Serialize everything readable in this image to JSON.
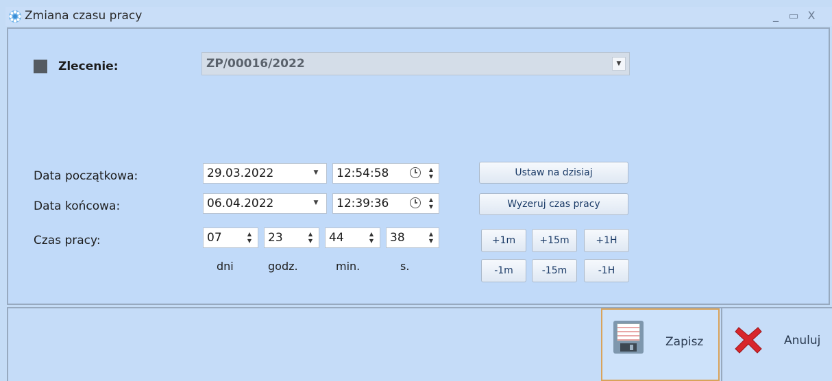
{
  "window": {
    "title": "Zmiana czasu pracy",
    "controls": {
      "minimize": "_",
      "maximize": "▭",
      "close": "X"
    }
  },
  "order": {
    "label": "Zlecenie:",
    "value": "ZP/00016/2022"
  },
  "start": {
    "label": "Data początkowa:",
    "date": "29.03.2022",
    "time": "12:54:58"
  },
  "end": {
    "label": "Data końcowa:",
    "date": "06.04.2022",
    "time": "12:39:36"
  },
  "worktime": {
    "label": "Czas pracy:",
    "days": "07",
    "hours": "23",
    "minutes": "44",
    "seconds": "38",
    "units": {
      "days": "dni",
      "hours": "godz.",
      "minutes": "min.",
      "seconds": "s."
    }
  },
  "actions": {
    "set_today": "Ustaw na dzisiaj",
    "reset": "Wyzeruj czas pracy",
    "plus_1m": "+1m",
    "plus_15m": "+15m",
    "plus_1h": "+1H",
    "minus_1m": "-1m",
    "minus_15m": "-15m",
    "minus_1h": "-1H"
  },
  "footer": {
    "save": "Zapisz",
    "cancel": "Anuluj"
  },
  "colors": {
    "background": "#c1daf9",
    "order_flag": "#555b62",
    "save_border": "#d9a35a",
    "cancel_icon": "#d8262b"
  }
}
